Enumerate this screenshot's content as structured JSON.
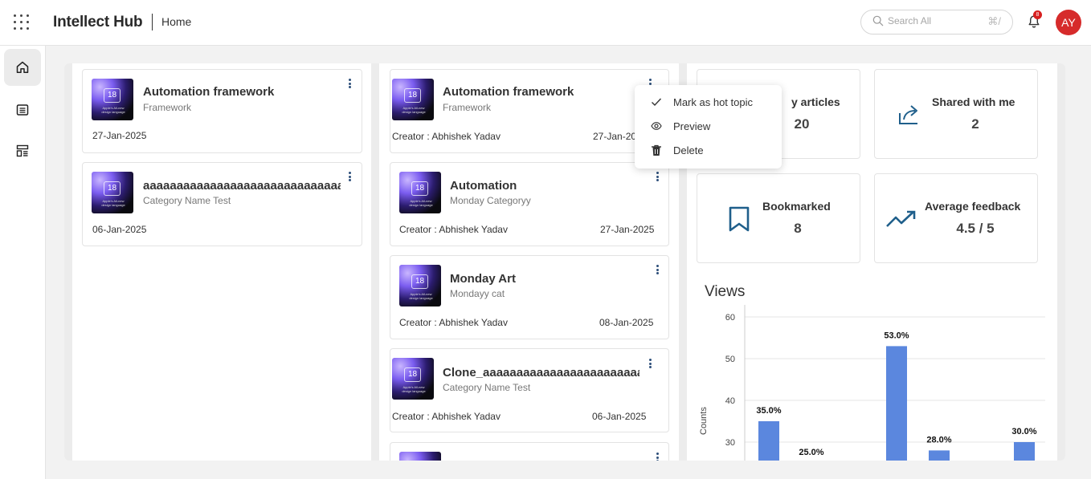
{
  "header": {
    "brand": "Intellect Hub",
    "breadcrumb": "Home",
    "search_placeholder": "Search All",
    "search_shortcut": "⌘/",
    "notification_count": "8",
    "avatar_initials": "AY"
  },
  "sidebar": {
    "items": [
      {
        "icon": "home-icon"
      },
      {
        "icon": "list-icon"
      },
      {
        "icon": "layout-icon"
      }
    ]
  },
  "left_column": {
    "cards": [
      {
        "title": "Automation framework",
        "category": "Framework",
        "date": "27-Jan-2025"
      },
      {
        "title": "aaaaaaaaaaaaaaaaaaaaaaaaaaaaaaaaaaa",
        "category": "Category Name Test",
        "date": "06-Jan-2025"
      }
    ]
  },
  "thumbnail": {
    "number": "18",
    "caption": "Apple's All-new design language"
  },
  "middle_column": {
    "cards": [
      {
        "title": "Automation framework",
        "category": "Framework",
        "creator": "Creator : Abhishek Yadav",
        "date": "27-Jan-2025"
      },
      {
        "title": "Automation",
        "category": "Monday Categoryy",
        "creator": "Creator : Abhishek Yadav",
        "date": "27-Jan-2025"
      },
      {
        "title": "Monday Art",
        "category": "Mondayy cat",
        "creator": "Creator : Abhishek Yadav",
        "date": "08-Jan-2025"
      },
      {
        "title": "Clone_aaaaaaaaaaaaaaaaaaaaaaaaaaa",
        "category": "Category Name Test",
        "creator": "Creator : Abhishek Yadav",
        "date": "06-Jan-2025"
      }
    ]
  },
  "context_menu": {
    "items": [
      {
        "label": "Mark as hot topic",
        "icon": "check-icon"
      },
      {
        "label": "Preview",
        "icon": "eye-icon"
      },
      {
        "label": "Delete",
        "icon": "trash-icon"
      }
    ]
  },
  "stats": {
    "my_articles": {
      "label": "My articles",
      "visible_label": "y articles",
      "value": "20"
    },
    "shared_with_me": {
      "label": "Shared with me",
      "value": "2",
      "icon": "share-icon"
    },
    "bookmarked": {
      "label": "Bookmarked",
      "value": "8",
      "icon": "bookmark-icon"
    },
    "average_feedback": {
      "label": "Average feedback",
      "value": "4.5 / 5",
      "icon": "trend-up-icon"
    }
  },
  "colors": {
    "accent": "#1f5f8b",
    "bar": "#5b87de",
    "avatar": "#d62b2b",
    "badge": "#d71f1f"
  },
  "chart_data": {
    "type": "bar",
    "title": "Views",
    "ylabel": "Counts",
    "xlabel": "",
    "ylim": [
      0,
      60
    ],
    "yticks": [
      "60",
      "50",
      "40",
      "30"
    ],
    "grid": true,
    "values": [
      35,
      25,
      53,
      28,
      30
    ],
    "data_labels": [
      "35.0%",
      "25.0%",
      "53.0%",
      "28.0%",
      "30.0%"
    ]
  }
}
